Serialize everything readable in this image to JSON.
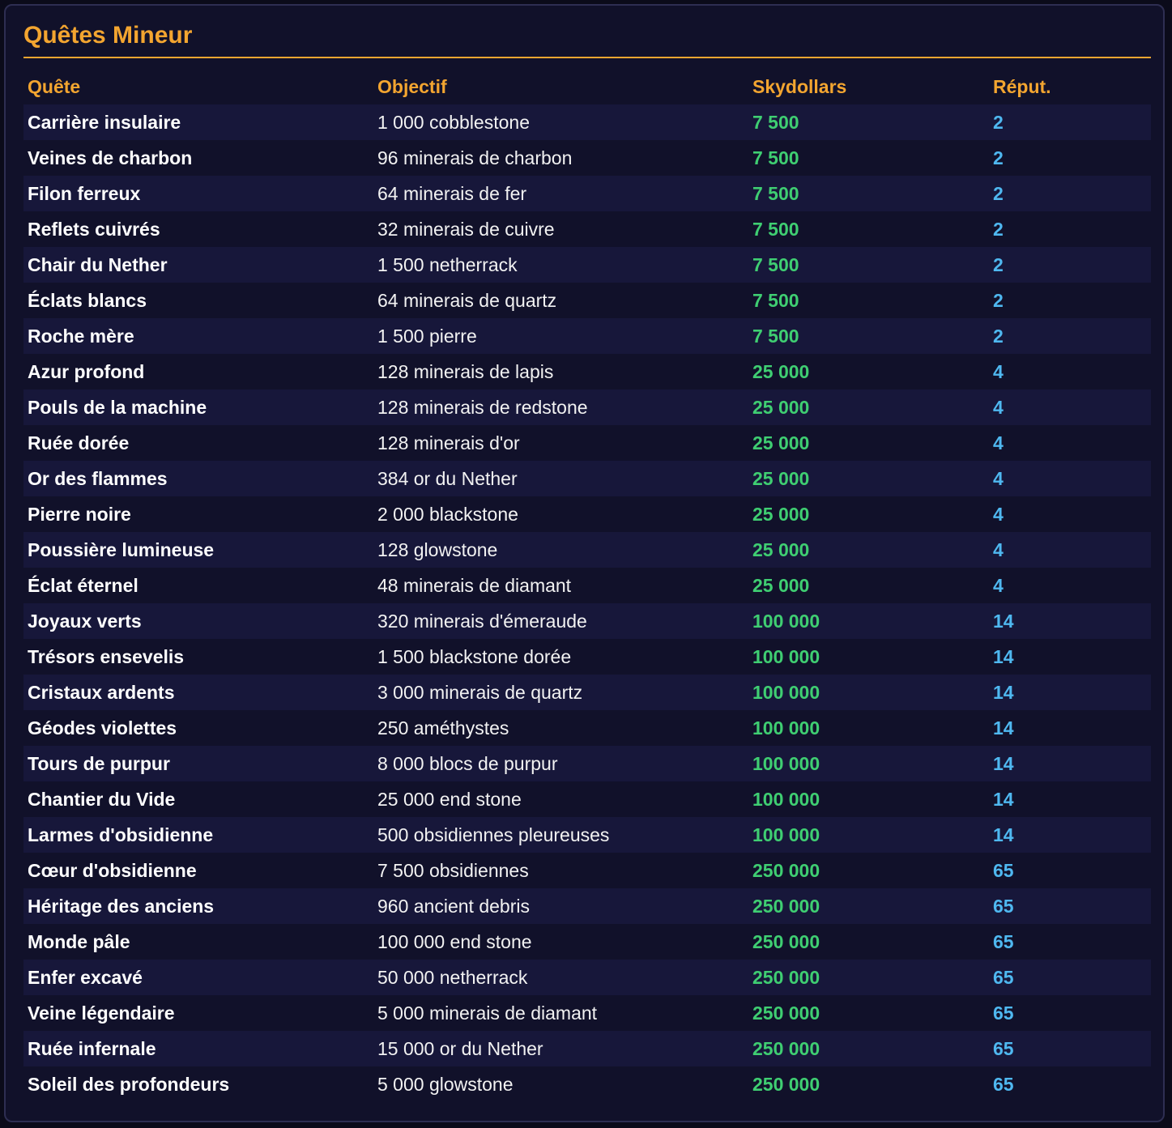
{
  "panel": {
    "title": "Quêtes Mineur"
  },
  "table": {
    "headers": {
      "quest": "Quête",
      "objective": "Objectif",
      "skydollars": "Skydollars",
      "reputation": "Réput."
    },
    "rows": [
      {
        "quest": "Carrière insulaire",
        "objective": "1 000 cobblestone",
        "skydollars": "7 500",
        "reputation": "2"
      },
      {
        "quest": "Veines de charbon",
        "objective": "96 minerais de charbon",
        "skydollars": "7 500",
        "reputation": "2"
      },
      {
        "quest": "Filon ferreux",
        "objective": "64 minerais de fer",
        "skydollars": "7 500",
        "reputation": "2"
      },
      {
        "quest": "Reflets cuivrés",
        "objective": "32 minerais de cuivre",
        "skydollars": "7 500",
        "reputation": "2"
      },
      {
        "quest": "Chair du Nether",
        "objective": "1 500 netherrack",
        "skydollars": "7 500",
        "reputation": "2"
      },
      {
        "quest": "Éclats blancs",
        "objective": "64 minerais de quartz",
        "skydollars": "7 500",
        "reputation": "2"
      },
      {
        "quest": "Roche mère",
        "objective": "1 500 pierre",
        "skydollars": "7 500",
        "reputation": "2"
      },
      {
        "quest": "Azur profond",
        "objective": "128 minerais de lapis",
        "skydollars": "25 000",
        "reputation": "4"
      },
      {
        "quest": "Pouls de la machine",
        "objective": "128 minerais de redstone",
        "skydollars": "25 000",
        "reputation": "4"
      },
      {
        "quest": "Ruée dorée",
        "objective": "128 minerais d'or",
        "skydollars": "25 000",
        "reputation": "4"
      },
      {
        "quest": "Or des flammes",
        "objective": "384 or du Nether",
        "skydollars": "25 000",
        "reputation": "4"
      },
      {
        "quest": "Pierre noire",
        "objective": "2 000 blackstone",
        "skydollars": "25 000",
        "reputation": "4"
      },
      {
        "quest": "Poussière lumineuse",
        "objective": "128 glowstone",
        "skydollars": "25 000",
        "reputation": "4"
      },
      {
        "quest": "Éclat éternel",
        "objective": "48 minerais de diamant",
        "skydollars": "25 000",
        "reputation": "4"
      },
      {
        "quest": "Joyaux verts",
        "objective": "320 minerais d'émeraude",
        "skydollars": "100 000",
        "reputation": "14"
      },
      {
        "quest": "Trésors ensevelis",
        "objective": "1 500 blackstone dorée",
        "skydollars": "100 000",
        "reputation": "14"
      },
      {
        "quest": "Cristaux ardents",
        "objective": "3 000 minerais de quartz",
        "skydollars": "100 000",
        "reputation": "14"
      },
      {
        "quest": "Géodes violettes",
        "objective": "250 améthystes",
        "skydollars": "100 000",
        "reputation": "14"
      },
      {
        "quest": "Tours de purpur",
        "objective": "8 000 blocs de purpur",
        "skydollars": "100 000",
        "reputation": "14"
      },
      {
        "quest": "Chantier du Vide",
        "objective": "25 000 end stone",
        "skydollars": "100 000",
        "reputation": "14"
      },
      {
        "quest": "Larmes d'obsidienne",
        "objective": "500 obsidiennes pleureuses",
        "skydollars": "100 000",
        "reputation": "14"
      },
      {
        "quest": "Cœur d'obsidienne",
        "objective": "7 500 obsidiennes",
        "skydollars": "250 000",
        "reputation": "65"
      },
      {
        "quest": "Héritage des anciens",
        "objective": "960 ancient debris",
        "skydollars": "250 000",
        "reputation": "65"
      },
      {
        "quest": "Monde pâle",
        "objective": "100 000 end stone",
        "skydollars": "250 000",
        "reputation": "65"
      },
      {
        "quest": "Enfer excavé",
        "objective": "50 000 netherrack",
        "skydollars": "250 000",
        "reputation": "65"
      },
      {
        "quest": "Veine légendaire",
        "objective": "5 000 minerais de diamant",
        "skydollars": "250 000",
        "reputation": "65"
      },
      {
        "quest": "Ruée infernale",
        "objective": "15 000 or du Nether",
        "skydollars": "250 000",
        "reputation": "65"
      },
      {
        "quest": "Soleil des profondeurs",
        "objective": "5 000 glowstone",
        "skydollars": "250 000",
        "reputation": "65"
      }
    ]
  },
  "colors": {
    "accent": "#f3a530",
    "skydollars": "#3fce72",
    "reputation": "#4fb8f0",
    "panel_bg": "#11112a",
    "row_alt_bg": "#17173a"
  }
}
